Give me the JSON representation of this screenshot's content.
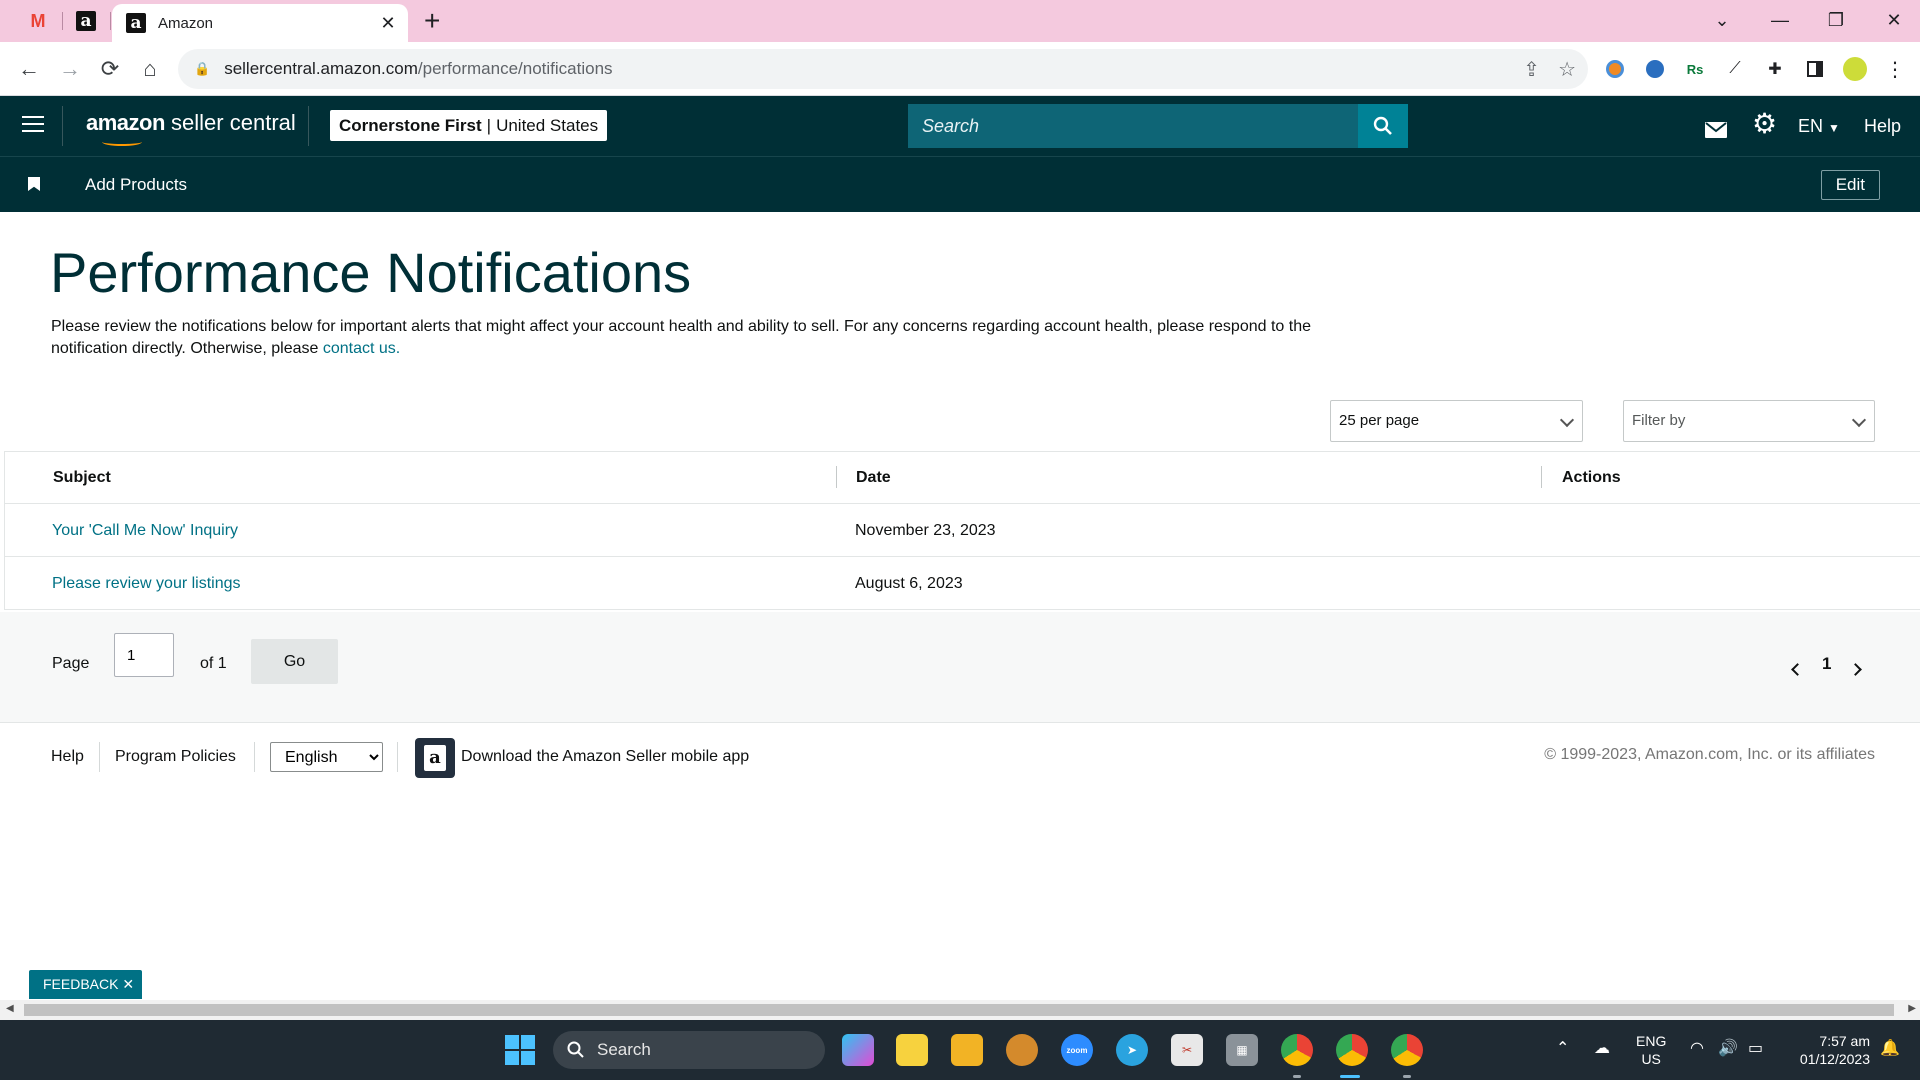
{
  "browser": {
    "active_tab_title": "Amazon",
    "url_host": "sellercentral.amazon.com",
    "url_path": "/performance/notifications"
  },
  "header": {
    "logo_amazon": "amazon",
    "logo_rest": "seller central",
    "store_name": "Cornerstone First",
    "store_sep": "|",
    "store_country": "United States",
    "search_placeholder": "Search",
    "language": "EN",
    "help": "Help"
  },
  "bookmarks": {
    "item": "Add Products",
    "edit": "Edit"
  },
  "page": {
    "title": "Performance Notifications",
    "intro_line1": "Please review the notifications below for important alerts that might affect your account health and ability to sell. For any concerns regarding account health, please",
    "intro_line2": "respond to the notification directly. Otherwise, please",
    "contact_link": "contact us."
  },
  "controls": {
    "per_page": "25 per page",
    "filter": "Filter by"
  },
  "table": {
    "headers": [
      "Subject",
      "Date",
      "Actions"
    ],
    "rows": [
      {
        "subject": "Your 'Call Me Now' Inquiry",
        "date": "November 23, 2023"
      },
      {
        "subject": "Please review your listings",
        "date": "August 6, 2023"
      }
    ]
  },
  "pager": {
    "page_label": "Page",
    "page_value": "1",
    "of_label": "of 1",
    "go": "Go",
    "current": "1"
  },
  "footer": {
    "help": "Help",
    "policies": "Program Policies",
    "language": "English",
    "app": "Download the Amazon Seller mobile app",
    "copyright": "© 1999-2023, Amazon.com, Inc. or its affiliates"
  },
  "feedback": "FEEDBACK ✕",
  "taskbar": {
    "search": "Search",
    "lang_top": "ENG",
    "lang_bottom": "US",
    "time": "7:57 am",
    "date": "01/12/2023"
  },
  "colors": {
    "header_bg": "#002f36",
    "search_bg": "#0e6576",
    "link": "#007185",
    "tab_strip": "#f4c9de"
  }
}
